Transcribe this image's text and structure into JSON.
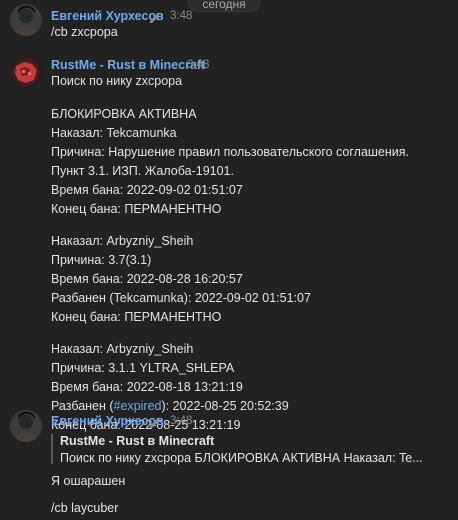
{
  "date_divider": "сегодня",
  "messages": [
    {
      "author": "Евгений Хурхесов",
      "time": "3:48",
      "lines": [
        "/cb zxcpopa"
      ]
    },
    {
      "author": "RustMe - Rust в Minecraft",
      "time": "3:48",
      "lines": [
        "Поиск по нику zxcpopa",
        "",
        "БЛОКИРОВКА АКТИВНА",
        "Наказал: Tekcamunka",
        "Причина: Нарушение правил пользовательского соглашения.",
        "Пункт 3.1. ИЗП. Жалоба-19101.",
        "Время бана: 2022-09-02 01:51:07",
        "Конец бана: ПЕРМАНЕНТНО",
        "",
        "Наказал: Arbyzniy_Sheih",
        "Причина: 3.7(3.1)",
        "Время бана: 2022-08-28 16:20:57",
        "Разбанен (Tekcamunka): 2022-09-02 01:51:07",
        "Конец бана: ПЕРМАНЕНТНО",
        "",
        "Наказал: Arbyzniy_Sheih",
        "Причина: 3.1.1 YLTRA_SHLEPA",
        "Время бана: 2022-08-18 13:21:19",
        "Конец бана: 2022-08-25 13:21:19"
      ],
      "expired_line": {
        "prefix": "Разбанен (",
        "hashtag": "#expired",
        "suffix": "): 2022-08-25 20:52:39"
      }
    },
    {
      "author": "Евгений Хурхесов",
      "time": "3:48",
      "reply": {
        "author": "RustMe - Rust в Minecraft",
        "text": "Поиск по нику zxcpopa БЛОКИРОВКА АКТИВНА Наказал: Te..."
      },
      "lines": [
        "Я ошарашен",
        "",
        "/cb laycuber"
      ]
    }
  ],
  "colors": {
    "background": "#222222",
    "author": "#71aaeb",
    "text": "#e1e3e6",
    "muted": "#8a8a8a",
    "hashtag": "#71aaeb"
  }
}
